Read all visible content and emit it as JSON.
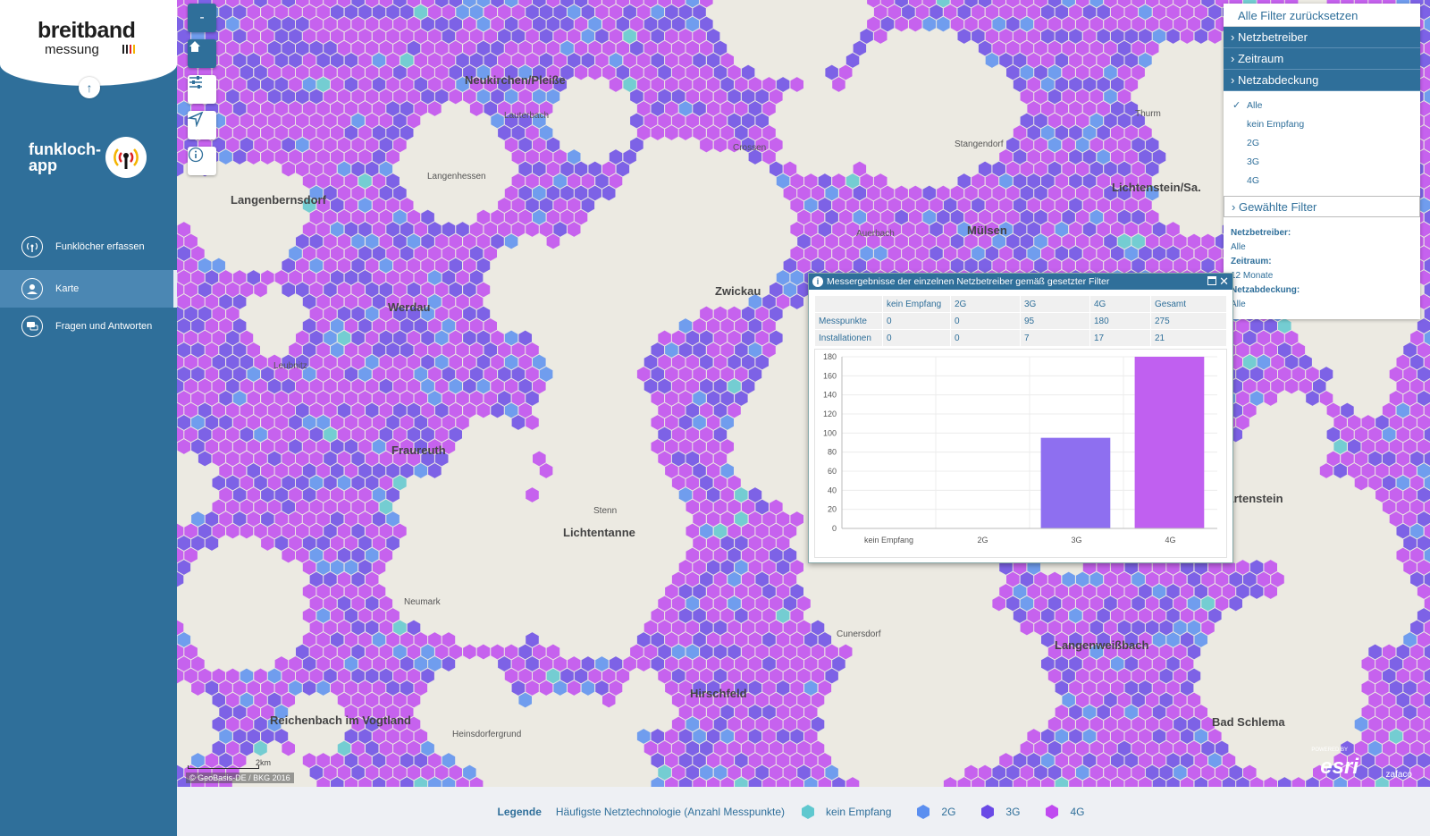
{
  "sidebar": {
    "logo_main": "breitband",
    "logo_sub": "messung",
    "app_title": "funkloch-app",
    "nav": [
      {
        "label": "Funklöcher erfassen"
      },
      {
        "label": "Karte"
      },
      {
        "label": "Fragen und Antworten"
      }
    ]
  },
  "map": {
    "zoom_out": "-",
    "copyright": "© GeoBasis-DE / BKG 2016",
    "scale": "2km",
    "esri_powered": "POWERED BY",
    "esri": "esri",
    "zafaco": "zafaco",
    "towns": [
      {
        "name": "Neukirchen/Pleiße"
      },
      {
        "name": "Langenbernsdorf"
      },
      {
        "name": "Werdau"
      },
      {
        "name": "Zwickau"
      },
      {
        "name": "Fraureuth"
      },
      {
        "name": "Lichtentanne"
      },
      {
        "name": "Neumark"
      },
      {
        "name": "Hirschfeld"
      },
      {
        "name": "Reichenbach im Vogtland"
      },
      {
        "name": "Heinsdorfergrund"
      },
      {
        "name": "Mülsen"
      },
      {
        "name": "Lichtenstein/Sa."
      },
      {
        "name": "Hartenstein"
      },
      {
        "name": "Langenweißbach"
      },
      {
        "name": "Thurm"
      },
      {
        "name": "Auerbach"
      },
      {
        "name": "Leubnitz"
      },
      {
        "name": "Lauterbach"
      },
      {
        "name": "Langenhessen"
      },
      {
        "name": "Stenn"
      },
      {
        "name": "Crossen"
      },
      {
        "name": "Cunersdorf"
      },
      {
        "name": "Bad Schlema"
      },
      {
        "name": "Stangendorf"
      }
    ]
  },
  "filters": {
    "reset": "Alle Filter zurücksetzen",
    "sections": [
      "Netzbetreiber",
      "Zeitraum",
      "Netzabdeckung"
    ],
    "coverage_options": [
      "Alle",
      "kein Empfang",
      "2G",
      "3G",
      "4G"
    ],
    "selected_title": "Gewählte Filter",
    "selected": [
      {
        "key": "Netzbetreiber:",
        "value": "Alle"
      },
      {
        "key": "Zeitraum:",
        "value": "12 Monate"
      },
      {
        "key": "Netzabdeckung:",
        "value": "Alle"
      }
    ]
  },
  "popup": {
    "title": "Messergebnisse der einzelnen Netzbetreiber gemäß gesetzter Filter",
    "columns": [
      "",
      "kein Empfang",
      "2G",
      "3G",
      "4G",
      "Gesamt"
    ],
    "rows": [
      {
        "label": "Messpunkte",
        "values": [
          "0",
          "0",
          "95",
          "180",
          "275"
        ]
      },
      {
        "label": "Installationen",
        "values": [
          "0",
          "0",
          "7",
          "17",
          "21"
        ]
      }
    ]
  },
  "chart_data": {
    "type": "bar",
    "categories": [
      "kein Empfang",
      "2G",
      "3G",
      "4G"
    ],
    "values": [
      0,
      0,
      95,
      180
    ],
    "colors": [
      "#5fd3c6",
      "#5b9cf0",
      "#8e6ff0",
      "#c060f0"
    ],
    "ylim": [
      0,
      180
    ],
    "yticks": [
      0,
      20,
      40,
      60,
      80,
      100,
      120,
      140,
      160,
      180
    ],
    "grid": true
  },
  "legend": {
    "title": "Legende",
    "subtitle": "Häufigste Netztechnologie (Anzahl Messpunkte)",
    "items": [
      {
        "label": "kein Empfang",
        "color": "#5fc8cf"
      },
      {
        "label": "2G",
        "color": "#5b8ff0"
      },
      {
        "label": "3G",
        "color": "#6a4ae6"
      },
      {
        "label": "4G",
        "color": "#c04af0"
      }
    ]
  }
}
